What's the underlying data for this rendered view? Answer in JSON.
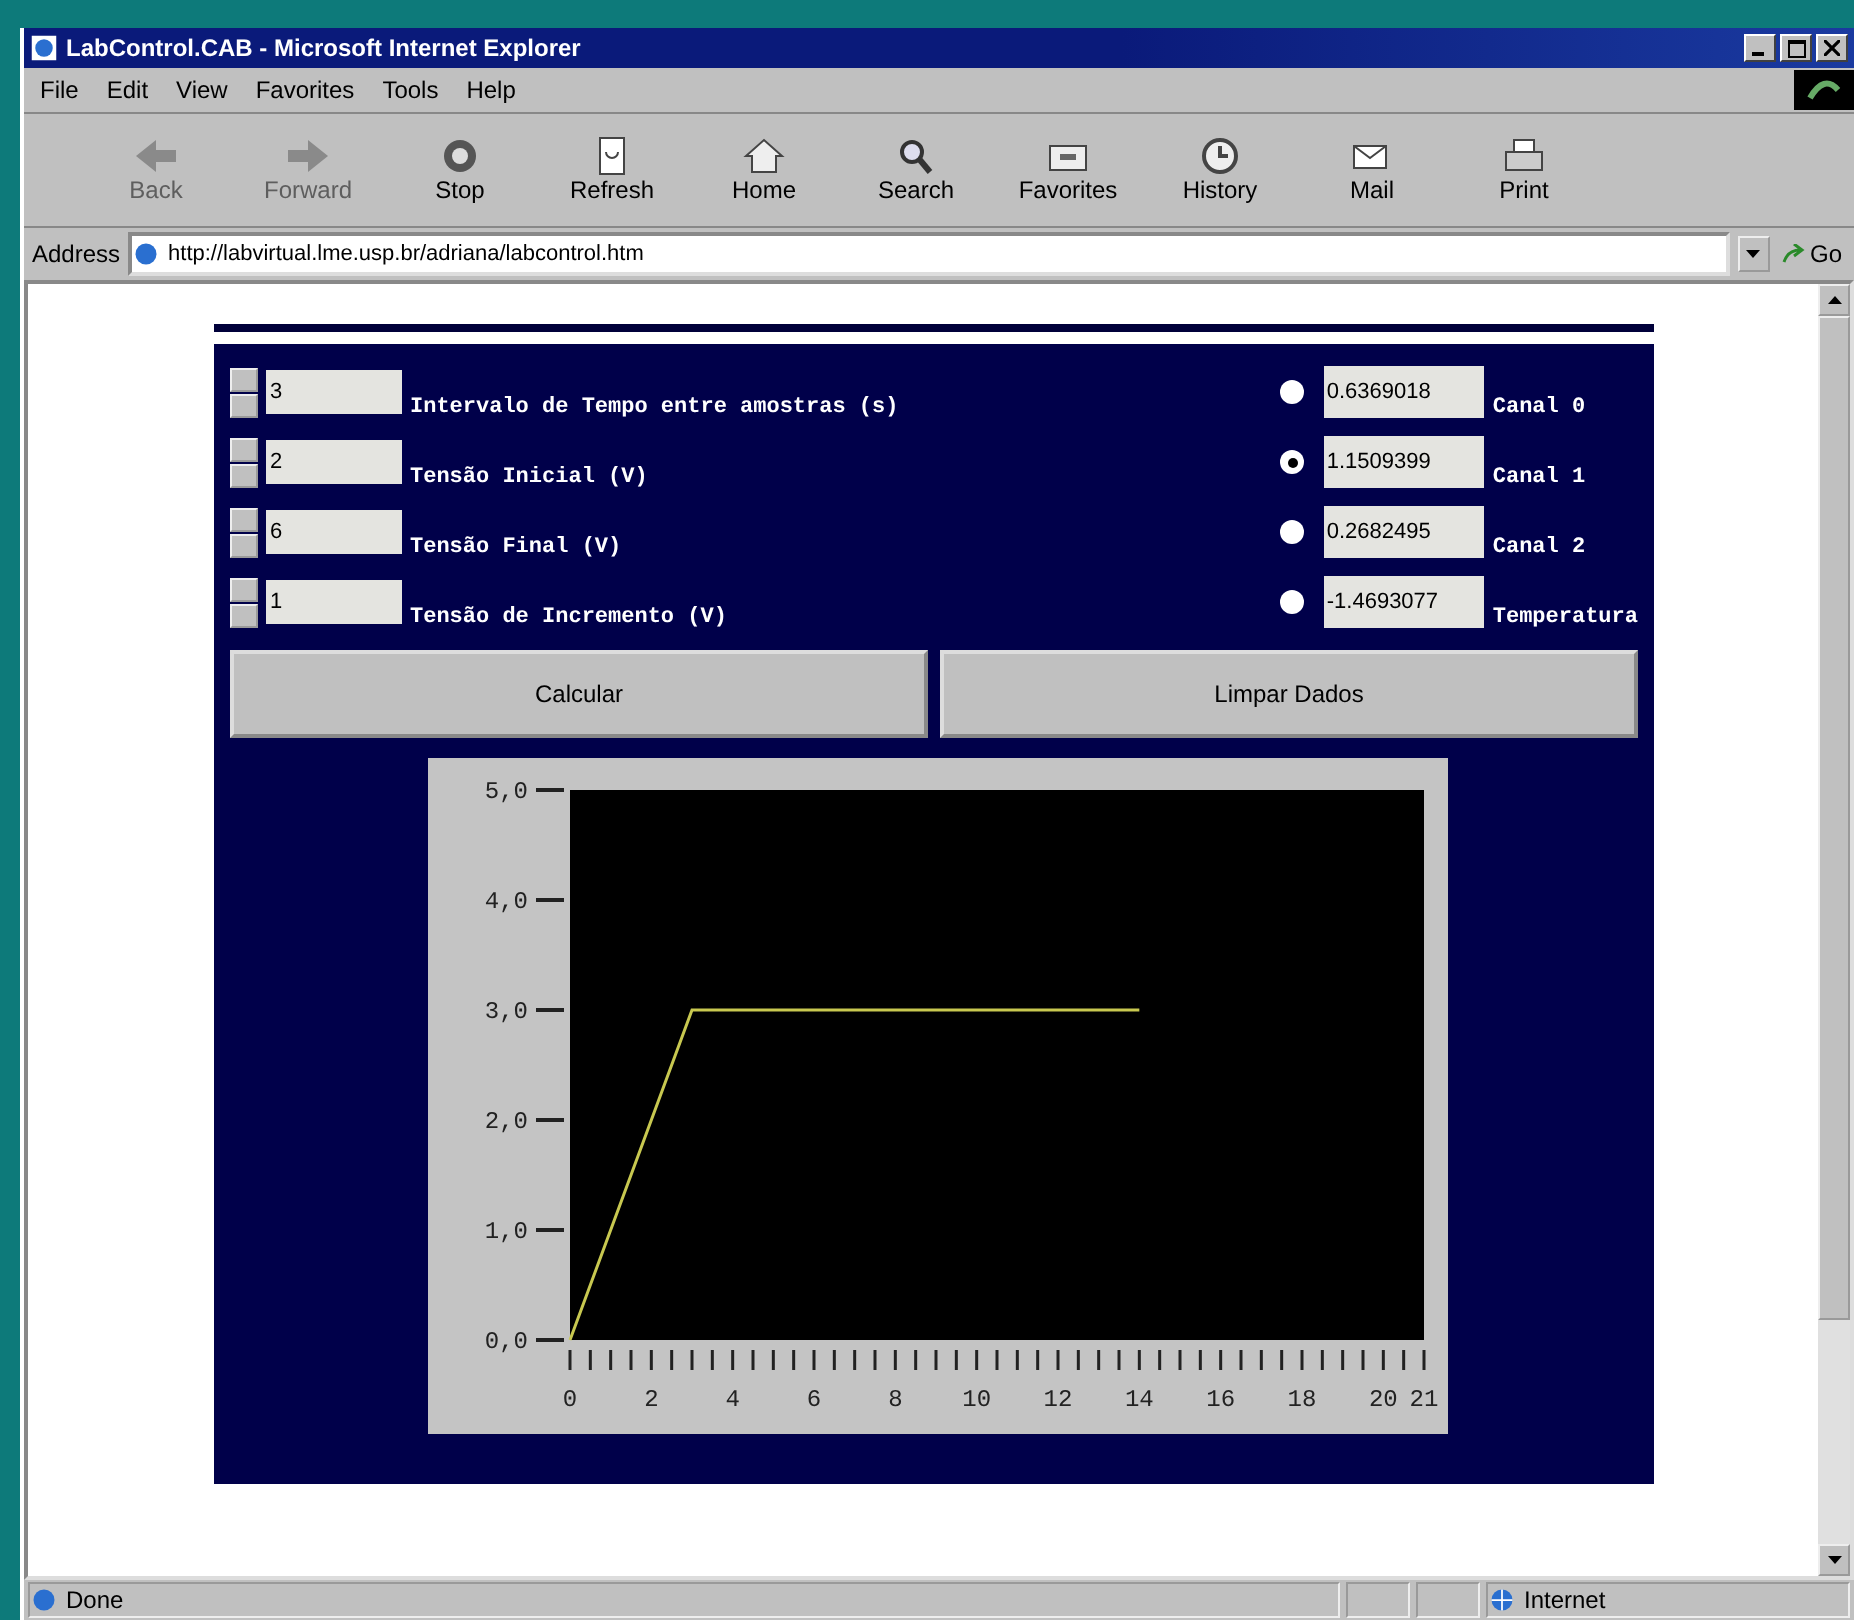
{
  "window": {
    "title": "LabControl.CAB - Microsoft Internet Explorer"
  },
  "menu": [
    "File",
    "Edit",
    "View",
    "Favorites",
    "Tools",
    "Help"
  ],
  "toolbar": [
    {
      "kind": "back",
      "label": "Back",
      "disabled": true
    },
    {
      "kind": "forward",
      "label": "Forward",
      "disabled": true
    },
    {
      "kind": "stop",
      "label": "Stop",
      "disabled": false
    },
    {
      "kind": "refresh",
      "label": "Refresh",
      "disabled": false
    },
    {
      "kind": "home",
      "label": "Home",
      "disabled": false
    },
    {
      "kind": "search",
      "label": "Search",
      "disabled": false
    },
    {
      "kind": "favorites",
      "label": "Favorites",
      "disabled": false
    },
    {
      "kind": "history",
      "label": "History",
      "disabled": false
    },
    {
      "kind": "mail",
      "label": "Mail",
      "disabled": false
    },
    {
      "kind": "print",
      "label": "Print",
      "disabled": false
    }
  ],
  "address": {
    "label": "Address",
    "value": "http://labvirtual.lme.usp.br/adriana/labcontrol.htm",
    "go": "Go"
  },
  "params": [
    {
      "value": "3",
      "label": "Intervalo de Tempo entre amostras (s)"
    },
    {
      "value": "2",
      "label": "Tensão Inicial (V)"
    },
    {
      "value": "6",
      "label": "Tensão Final (V)"
    },
    {
      "value": "1",
      "label": "Tensão de Incremento (V)"
    }
  ],
  "channels": [
    {
      "selected": false,
      "value": "0.6369018",
      "label": "Canal 0"
    },
    {
      "selected": true,
      "value": "1.1509399",
      "label": "Canal 1"
    },
    {
      "selected": false,
      "value": "0.2682495",
      "label": "Canal 2"
    },
    {
      "selected": false,
      "value": "-1.4693077",
      "label": "Temperatura"
    }
  ],
  "buttons": [
    "Calcular",
    "Limpar Dados"
  ],
  "chart": {
    "chart_data": {
      "type": "line",
      "x": [
        0,
        3,
        14
      ],
      "series": [
        {
          "color": "#c8c850",
          "values": [
            0,
            3,
            3
          ]
        }
      ],
      "xlim": [
        0,
        21
      ],
      "ylim": [
        0,
        5
      ],
      "xticks": [
        0,
        2,
        4,
        6,
        8,
        10,
        12,
        14,
        16,
        18,
        20,
        21
      ],
      "yticks": [
        {
          "value": 0,
          "label": "0,0"
        },
        {
          "value": 1,
          "label": "1,0"
        },
        {
          "value": 2,
          "label": "2,0"
        },
        {
          "value": 3,
          "label": "3,0"
        },
        {
          "value": 4,
          "label": "4,0"
        },
        {
          "value": 5,
          "label": "5,0"
        }
      ]
    }
  },
  "status_bar": {
    "text": "Done",
    "zone": "Internet"
  }
}
